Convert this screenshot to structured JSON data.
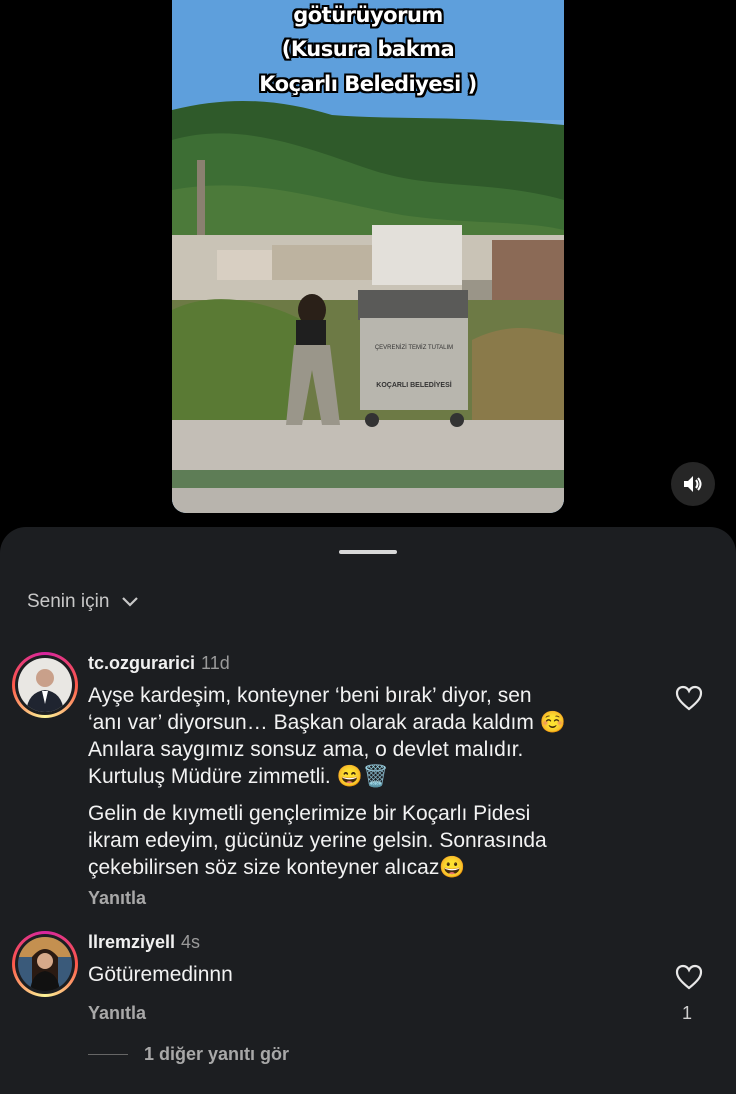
{
  "video": {
    "caption_lines": [
      "götürüyorum",
      "(Kusura bakma",
      "Koçarlı Belediyesi )"
    ],
    "bin_label": "KOÇARLI BELEDİYESİ",
    "bin_sublabel": "ÇEVRENİZİ TEMİZ TUTALIM",
    "mute_icon": "speaker-icon"
  },
  "sheet": {
    "filter_label": "Senin için"
  },
  "comments": [
    {
      "username": "tc.ozgurarici",
      "time": "11d",
      "lines": [
        "Ayşe kardeşim, konteyner ‘beni bırak’ diyor, sen",
        "‘anı var’ diyorsun… Başkan olarak arada kaldım ☺️",
        "Anılara saygımız sonsuz ama, o devlet malıdır.",
        "Kurtuluş Müdüre zimmetli. 😄🗑️",
        "Gelin de kıymetli gençlerimize bir Koçarlı Pidesi",
        "ikram edeyim, gücünüz yerine gelsin. Sonrasında",
        "çekebilirsen söz size konteyner alıcaz😀"
      ],
      "reply_label": "Yanıtla"
    },
    {
      "username": "llremziyell",
      "time": "4s",
      "text": "Götüremedinnn",
      "reply_label": "Yanıtla",
      "likes": "1"
    }
  ],
  "more_replies": "1 diğer yanıtı gör",
  "colors": {
    "sheet_bg": "#1c1e21",
    "page_bg": "#000000",
    "secondary_text": "#a8a8a8"
  }
}
